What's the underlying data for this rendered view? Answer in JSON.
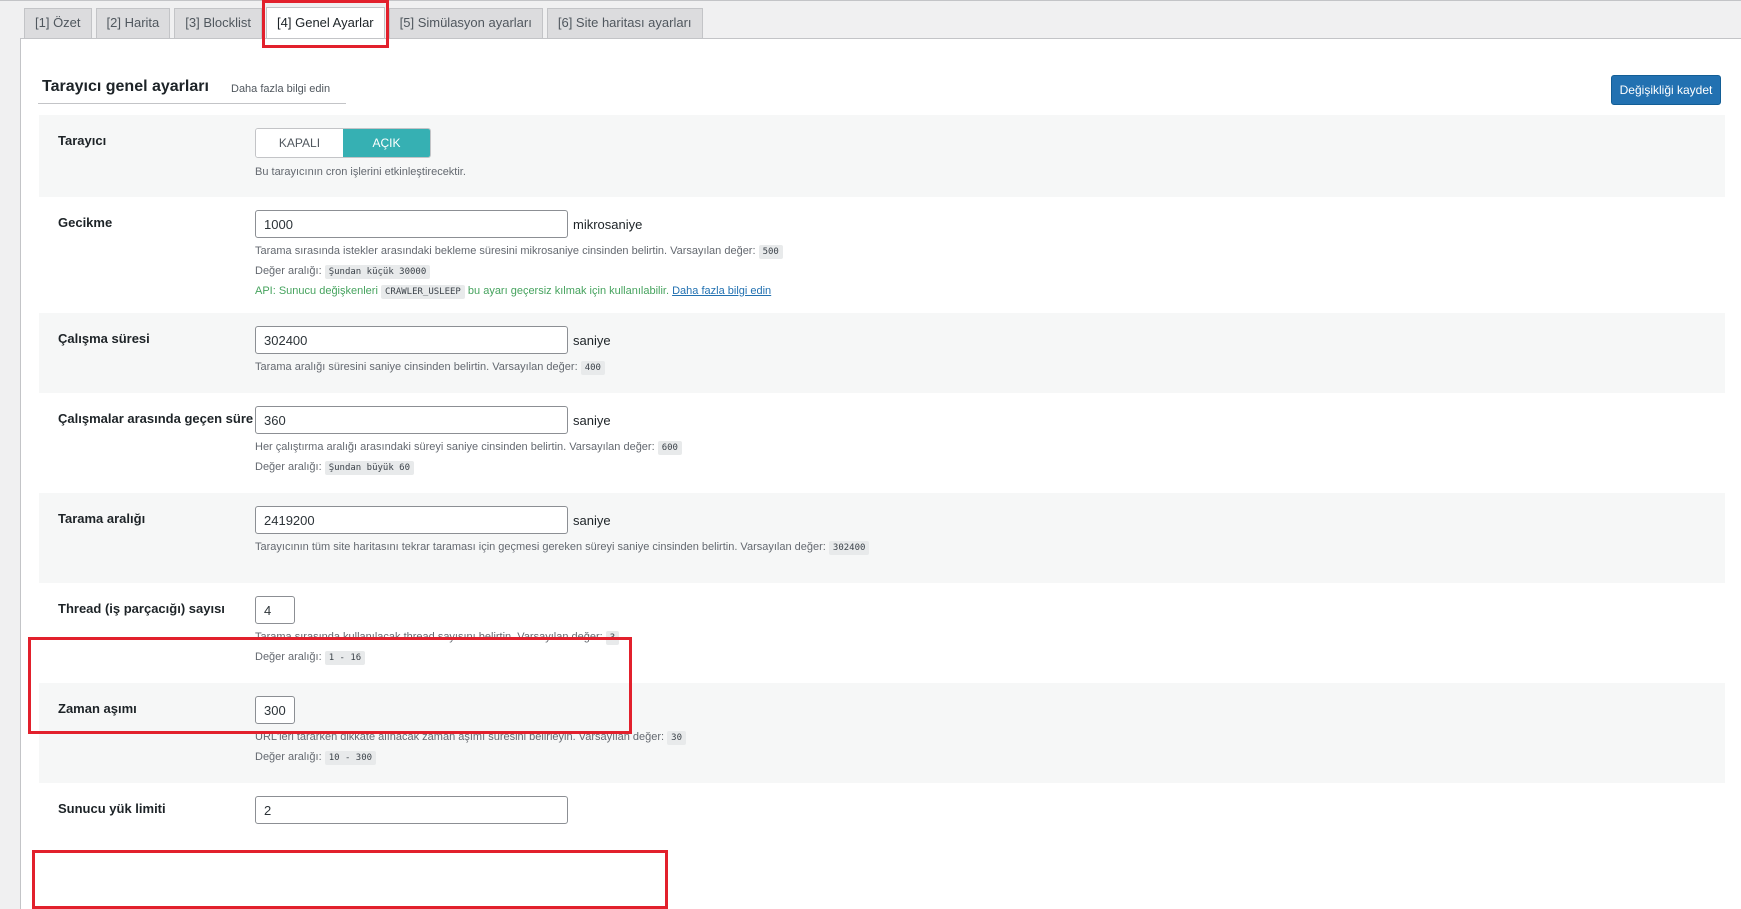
{
  "tabs": [
    {
      "label": "[1] Özet",
      "active": false
    },
    {
      "label": "[2] Harita",
      "active": false
    },
    {
      "label": "[3] Blocklist",
      "active": false
    },
    {
      "label": "[4] Genel Ayarlar",
      "active": true
    },
    {
      "label": "[5] Simülasyon ayarları",
      "active": false
    },
    {
      "label": "[6] Site haritası ayarları",
      "active": false
    }
  ],
  "header": {
    "title": "Tarayıcı genel ayarları",
    "learn_more": "Daha fazla bilgi edin",
    "save_label": "Değişikliği kaydet"
  },
  "settings": {
    "crawler": {
      "label": "Tarayıcı",
      "off_label": "KAPALI",
      "on_label": "AÇIK",
      "state": "on",
      "desc": "Bu tarayıcının cron işlerini etkinleştirecektir."
    },
    "delay": {
      "label": "Gecikme",
      "value": "1000",
      "unit": "mikrosaniye",
      "desc": "Tarama sırasında istekler arasındaki bekleme süresini mikrosaniye cinsinden belirtin. Varsayılan değer:",
      "default": "500",
      "range_label": "Değer aralığı:",
      "range": "Şundan küçük 30000",
      "api_prefix": "API: Sunucu değişkenleri",
      "api_code": "CRAWLER_USLEEP",
      "api_suffix": "bu ayarı geçersiz kılmak için kullanılabilir.",
      "api_link": "Daha fazla bilgi edin"
    },
    "run_duration": {
      "label": "Çalışma süresi",
      "value": "302400",
      "unit": "saniye",
      "desc": "Tarama aralığı süresini saniye cinsinden belirtin. Varsayılan değer:",
      "default": "400"
    },
    "run_interval": {
      "label": "Çalışmalar arasında geçen süre",
      "value": "360",
      "unit": "saniye",
      "desc": "Her çalıştırma aralığı arasındaki süreyi saniye cinsinden belirtin. Varsayılan değer:",
      "default": "600",
      "range_label": "Değer aralığı:",
      "range": "Şundan büyük 60"
    },
    "crawl_interval": {
      "label": "Tarama aralığı",
      "value": "2419200",
      "unit": "saniye",
      "desc": "Tarayıcının tüm site haritasını tekrar taraması için geçmesi gereken süreyi saniye cinsinden belirtin. Varsayılan değer:",
      "default": "302400"
    },
    "threads": {
      "label": "Thread (iş parçacığı) sayısı",
      "value": "4",
      "desc": "Tarama sırasında kullanılacak thread sayısını belirtin. Varsayılan değer:",
      "default": "3",
      "range_label": "Değer aralığı:",
      "range": "1 - 16"
    },
    "timeout": {
      "label": "Zaman aşımı",
      "value": "300",
      "desc": "URL'leri tararken dikkate alınacak zaman aşımı süresini belirleyin. Varsayılan değer:",
      "default": "30",
      "range_label": "Değer aralığı:",
      "range": "10 - 300"
    },
    "server_load": {
      "label": "Sunucu yük limiti",
      "value": "2"
    }
  },
  "colors": {
    "accent": "#2271b1",
    "toggle_on": "#36b0b3",
    "highlight": "#e2202c"
  }
}
